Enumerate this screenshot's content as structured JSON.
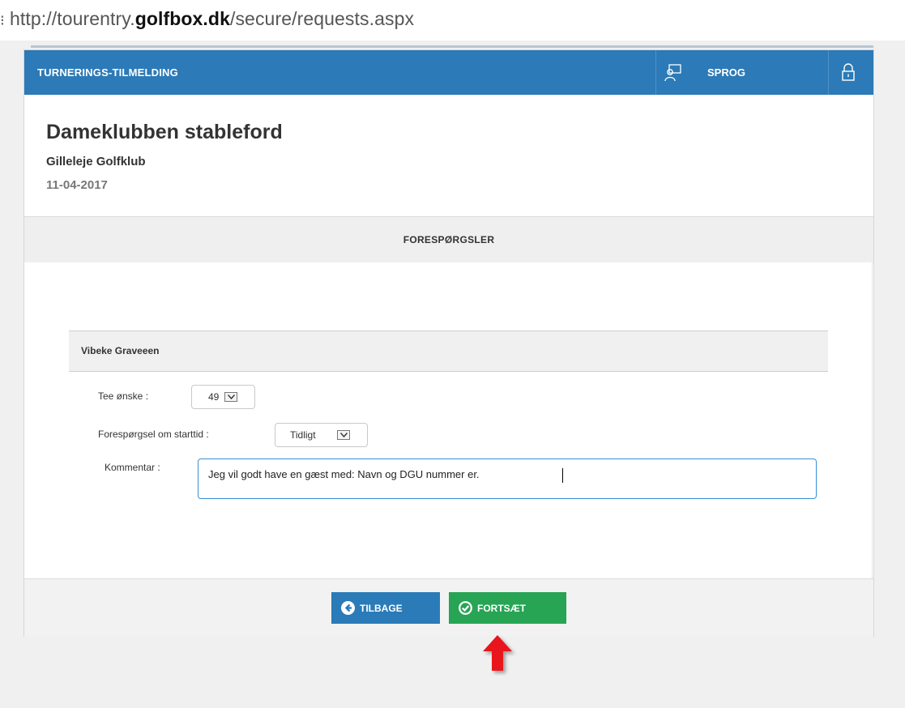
{
  "browser": {
    "url_prefix": "http://tourentry.",
    "url_domain": "golfbox.dk",
    "url_path": "/secure/requests.aspx"
  },
  "topbar": {
    "title": "TURNERINGS-TILMELDING",
    "language_label": "SPROG"
  },
  "tournament": {
    "name": "Dameklubben stableford",
    "club": "Gilleleje Golfklub",
    "date": "11-04-2017"
  },
  "section": {
    "title": "FORESPØRGSLER"
  },
  "player": {
    "name": "Vibeke Graveeen",
    "tee_label": "Tee ønske :",
    "tee_value": "49",
    "start_label": "Forespørgsel om starttid :",
    "start_value": "Tidligt",
    "comment_label": "Kommentar :",
    "comment_value": "Jeg vil godt have en gæst med: Navn og DGU nummer er."
  },
  "buttons": {
    "back": "TILBAGE",
    "next": "FORTSÆT"
  },
  "colors": {
    "topbar": "#2c7ab7",
    "back_button": "#2a7bb8",
    "next_button": "#27a454",
    "annotation_arrow": "#e8141b"
  }
}
